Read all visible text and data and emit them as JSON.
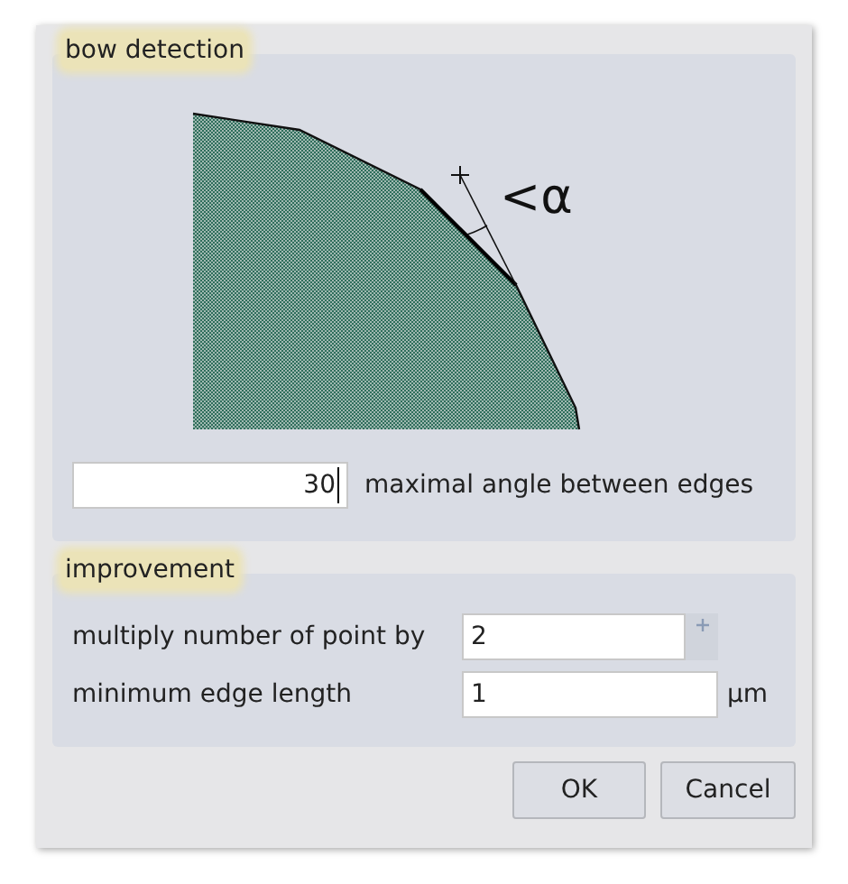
{
  "groups": [
    {
      "title": "bow detection"
    },
    {
      "title": "improvement"
    }
  ],
  "diagram": {
    "label": "<α"
  },
  "angle_field": {
    "value": "30",
    "label": "maximal angle between edges",
    "focused": true
  },
  "multiply": {
    "label": "multiply number of point by",
    "value": "2"
  },
  "min_edge": {
    "label": "minimum edge length",
    "value": "1",
    "unit": "µm"
  },
  "buttons": [
    {
      "label": "OK"
    },
    {
      "label": "Cancel"
    }
  ]
}
